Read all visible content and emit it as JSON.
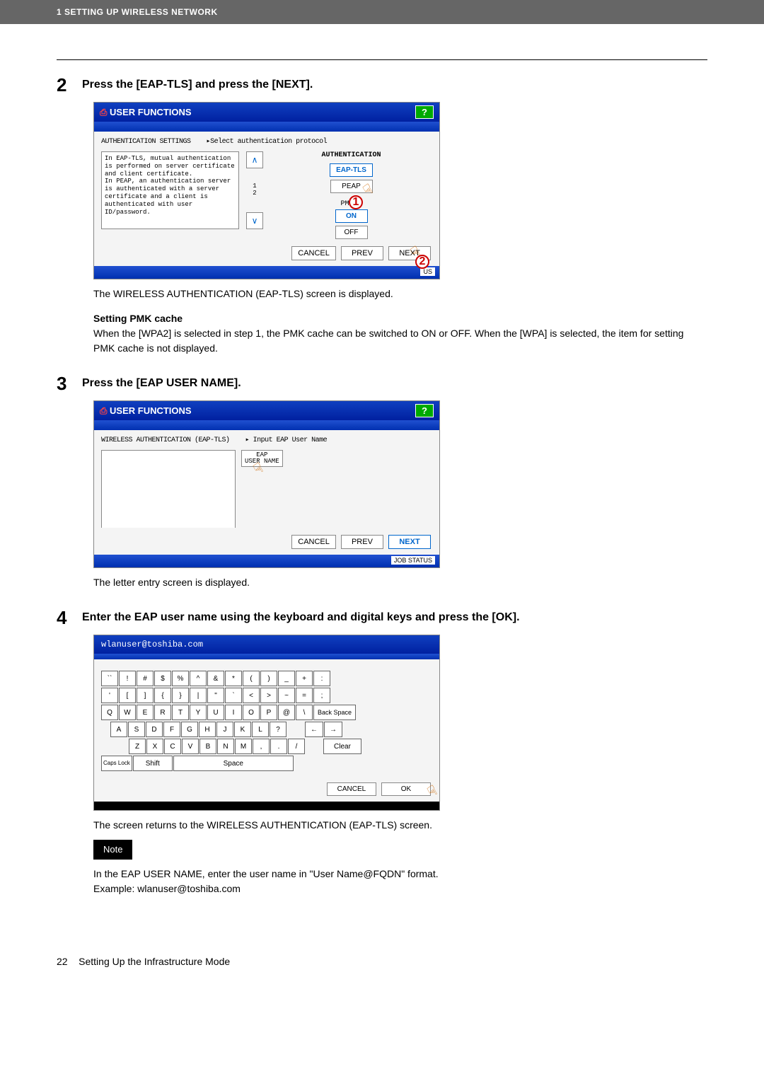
{
  "header": {
    "chapter": "1 SETTING UP WIRELESS NETWORK"
  },
  "step2": {
    "num": "2",
    "title": "Press the [EAP-TLS] and press the [NEXT].",
    "after_ss": "The WIRELESS AUTHENTICATION (EAP-TLS) screen is displayed.",
    "sub_heading": "Setting PMK cache",
    "sub_text": "When the [WPA2] is selected in step 1, the PMK cache can be switched to ON or OFF. When the [WPA] is selected, the item for setting PMK cache is not displayed."
  },
  "ss1": {
    "title": "USER FUNCTIONS",
    "help": "?",
    "subtitle_left": "AUTHENTICATION SETTINGS",
    "subtitle_right": "▸Select authentication protocol",
    "desc": "In EAP-TLS, mutual authentication is performed on server certificate and client certificate.\nIn PEAP, an authentication server is authenticated with a server certificate and a client is authenticated with user ID/password.",
    "page_top": "1",
    "page_bottom": "2",
    "auth_label": "AUTHENTICATION",
    "btn_eaptls": "EAP-TLS",
    "btn_peap": "PEAP",
    "pmk_label": "PMK C",
    "btn_on": "ON",
    "btn_off": "OFF",
    "cancel": "CANCEL",
    "prev": "PREV",
    "next": "NEXT",
    "status": "US",
    "callout1": "1",
    "callout2": "2"
  },
  "step3": {
    "num": "3",
    "title": "Press the [EAP USER NAME].",
    "after_ss": "The letter entry screen is displayed."
  },
  "ss2": {
    "title": "USER FUNCTIONS",
    "help": "?",
    "subtitle_left": "WIRELESS AUTHENTICATION (EAP-TLS)",
    "subtitle_right": "▸ Input EAP User Name",
    "field_label_top": "EAP",
    "field_label_bottom": "USER NAME",
    "cancel": "CANCEL",
    "prev": "PREV",
    "next": "NEXT",
    "status": "JOB STATUS"
  },
  "step4": {
    "num": "4",
    "title": "Enter the EAP user name using the keyboard and digital keys and press the [OK].",
    "after_ss": "The screen returns to the WIRELESS AUTHENTICATION (EAP-TLS) screen.",
    "note_label": "Note",
    "note_line1": "In the EAP USER NAME, enter the user name in \"User Name@FQDN\" format.",
    "note_line2": "Example: wlanuser@toshiba.com"
  },
  "ss3": {
    "input": "wlanuser@toshiba.com",
    "row1": [
      "``",
      "!",
      "#",
      "$",
      "%",
      "^",
      "&",
      "*",
      "(",
      ")",
      "_",
      "+",
      ":"
    ],
    "row2": [
      "'",
      "[",
      "]",
      "{",
      "}",
      "|",
      "\"",
      "`",
      "<",
      ">",
      "~",
      "=",
      ";"
    ],
    "row3": [
      "Q",
      "W",
      "E",
      "R",
      "T",
      "Y",
      "U",
      "I",
      "O",
      "P",
      "@",
      "\\",
      "Back Space"
    ],
    "row4": [
      "A",
      "S",
      "D",
      "F",
      "G",
      "H",
      "J",
      "K",
      "L",
      "?",
      "",
      "←",
      "→"
    ],
    "row5": [
      "Z",
      "X",
      "C",
      "V",
      "B",
      "N",
      "M",
      ",",
      ".",
      "/",
      "",
      "Clear"
    ],
    "caps": "Caps Lock",
    "shift": "Shift",
    "space": "Space",
    "cancel": "CANCEL",
    "ok": "OK"
  },
  "footer": {
    "page_num": "22",
    "page_title": "Setting Up the Infrastructure Mode"
  }
}
